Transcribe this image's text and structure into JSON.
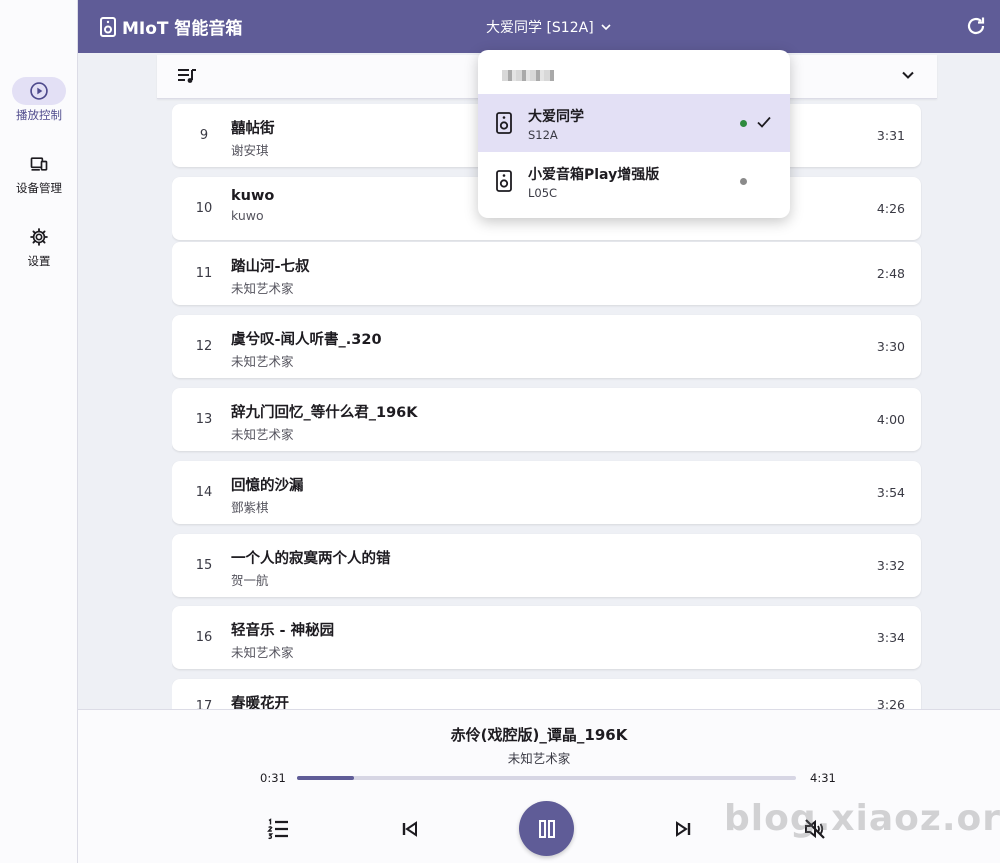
{
  "app": {
    "title": "MIoT 智能音箱"
  },
  "header": {
    "device_label": "大爱同学 [S12A]"
  },
  "nav": [
    {
      "label": "播放控制",
      "active": true,
      "icon": "play-circle-icon"
    },
    {
      "label": "设备管理",
      "active": false,
      "icon": "devices-icon"
    },
    {
      "label": "设置",
      "active": false,
      "icon": "gear-icon"
    }
  ],
  "songs": [
    {
      "index": "9",
      "title": "囍帖街",
      "artist": "谢安琪",
      "duration": "3:31"
    },
    {
      "index": "10",
      "title": "kuwo",
      "artist": "kuwo",
      "duration": "4:26"
    },
    {
      "index": "11",
      "title": "踏山河-七叔",
      "artist": "未知艺术家",
      "duration": "2:48"
    },
    {
      "index": "12",
      "title": "虞兮叹-闻人听書_.320",
      "artist": "未知艺术家",
      "duration": "3:30"
    },
    {
      "index": "13",
      "title": "辞九门回忆_等什么君_196K",
      "artist": "未知艺术家",
      "duration": "4:00"
    },
    {
      "index": "14",
      "title": "回憶的沙漏",
      "artist": "鄧紫棋",
      "duration": "3:54"
    },
    {
      "index": "15",
      "title": "一个人的寂寞两个人的错",
      "artist": "贺一航",
      "duration": "3:32"
    },
    {
      "index": "16",
      "title": "轻音乐 - 神秘园",
      "artist": "未知艺术家",
      "duration": "3:34"
    },
    {
      "index": "17",
      "title": "春暖花开",
      "artist": "",
      "duration": "3:26"
    }
  ],
  "player": {
    "title": "赤伶(戏腔版)_谭晶_196K",
    "artist": "未知艺术家",
    "elapsed": "0:31",
    "total": "4:31",
    "progress": 0.115
  },
  "device_menu": {
    "items": [
      {
        "name": "大爱同学",
        "model": "S12A",
        "selected": true,
        "status_color": "#2e8b3e"
      },
      {
        "name": "小爱音箱Play增强版",
        "model": "L05C",
        "selected": false,
        "status_color": "#8a8a8a"
      }
    ]
  },
  "watermark": "blog.xiaoz.org",
  "colors": {
    "primary": "#5f5c97",
    "selected_bg": "#e3e0f5"
  }
}
